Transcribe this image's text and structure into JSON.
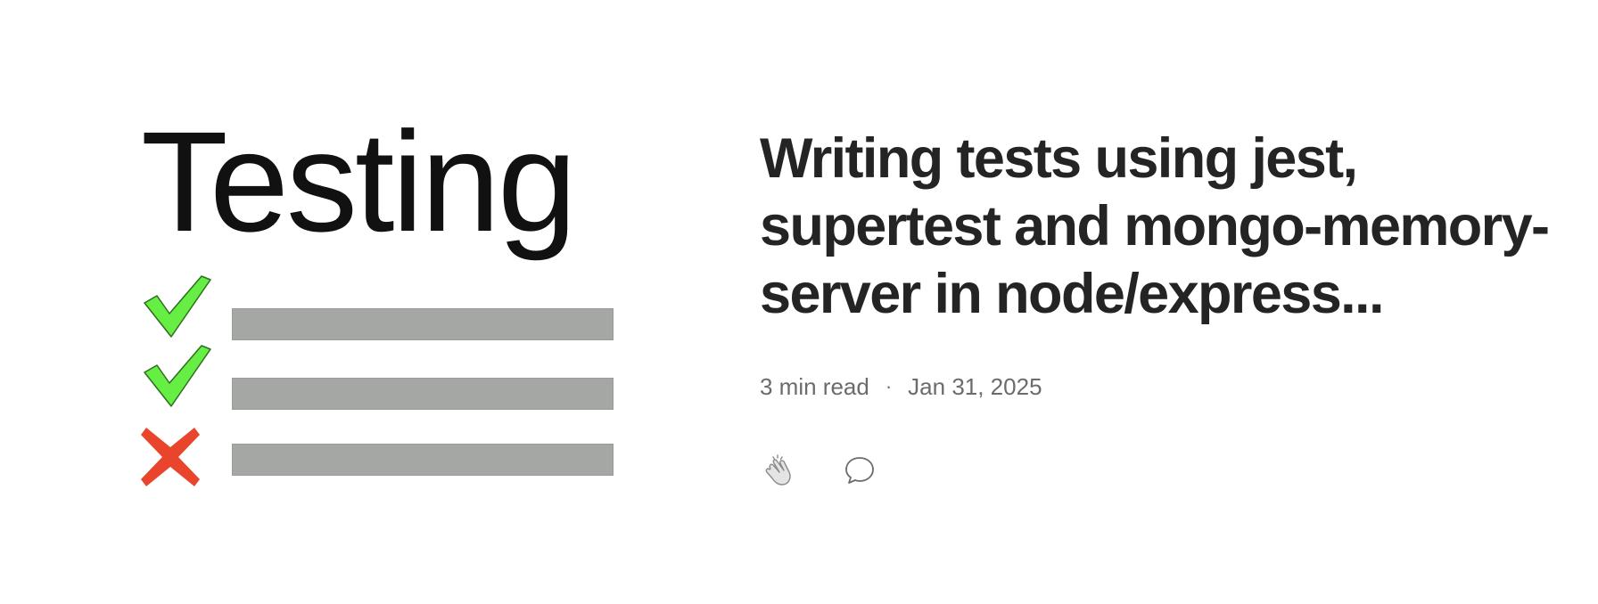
{
  "article": {
    "title": "Writing tests using jest, supertest and mongo-memory-server in node/express...",
    "read_time": "3 min read",
    "separator": "·",
    "date": "Jan 31, 2025"
  },
  "thumbnail": {
    "title": "Testing",
    "rows": [
      {
        "status": "pass",
        "icon": "check-icon",
        "color": "#66ee44"
      },
      {
        "status": "pass",
        "icon": "check-icon",
        "color": "#66ee44"
      },
      {
        "status": "fail",
        "icon": "cross-icon",
        "color": "#e8452c"
      }
    ],
    "bar_color": "#a5a7a5"
  },
  "actions": [
    {
      "name": "clap",
      "icon": "clap-icon"
    },
    {
      "name": "comment",
      "icon": "comment-icon"
    }
  ],
  "colors": {
    "title": "#242424",
    "meta": "#6b6b6b",
    "background": "#ffffff"
  }
}
